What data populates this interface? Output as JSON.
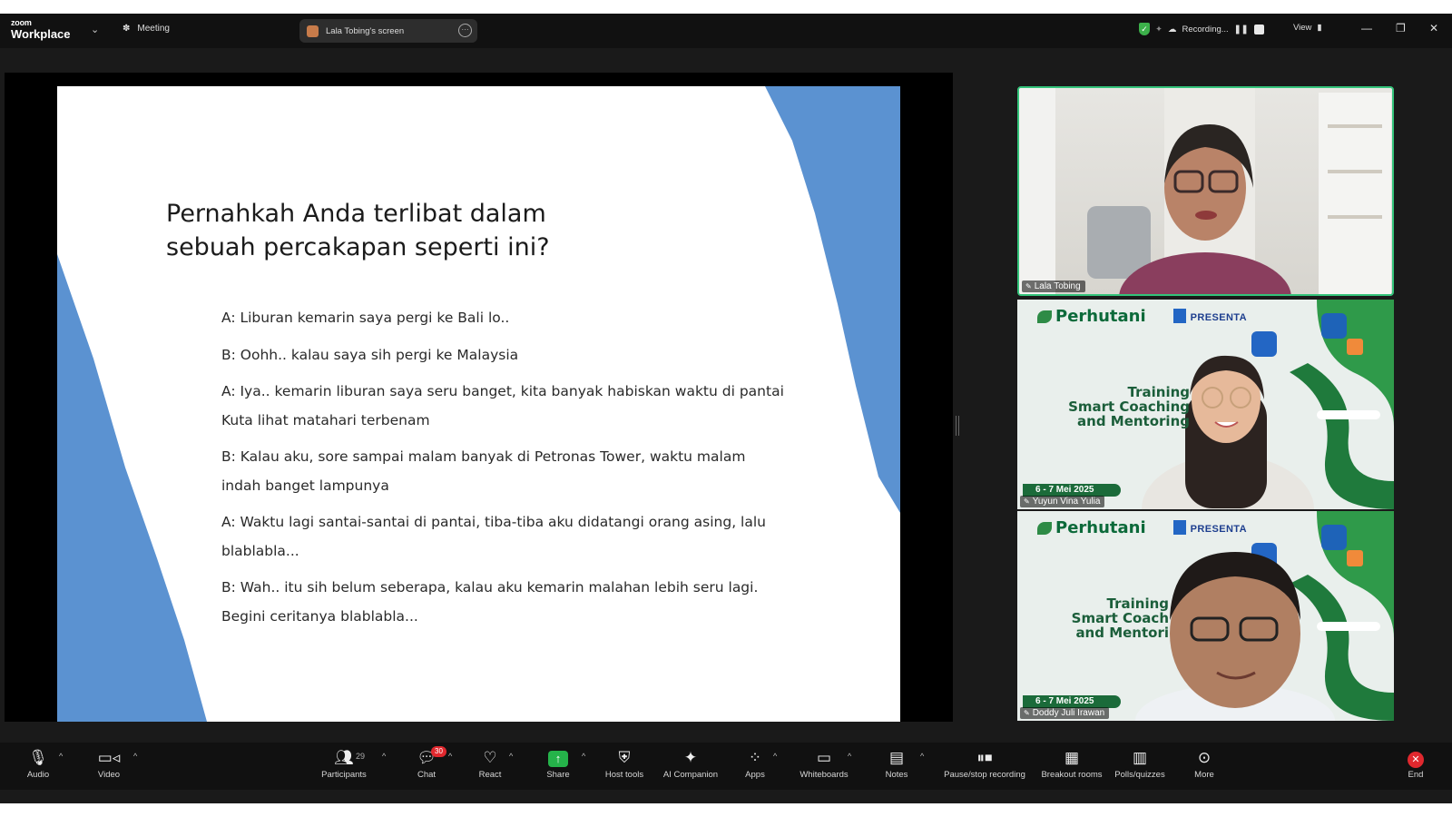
{
  "app": {
    "logo_top": "zoom",
    "logo_bottom": "Workplace",
    "meeting_label": "Meeting",
    "shared_screen_label": "Lala Tobing's screen",
    "recording_label": "Recording...",
    "view_label": "View"
  },
  "slide": {
    "title_line1": "Pernahkah Anda terlibat dalam",
    "title_line2": "sebuah percakapan seperti ini?",
    "lines": [
      "A: Liburan kemarin saya pergi ke Bali lo..",
      "B: Oohh.. kalau saya sih pergi ke Malaysia",
      "A: Iya.. kemarin liburan saya seru banget, kita banyak habiskan waktu di pantai Kuta lihat matahari terbenam",
      "B: Kalau aku, sore sampai malam banyak di Petronas Tower, waktu malam indah banget lampunya",
      "A: Waktu lagi santai-santai di pantai, tiba-tiba aku didatangi orang asing, lalu blablabla...",
      "B: Wah.. itu sih belum seberapa, kalau aku kemarin malahan lebih seru lagi. Begini ceritanya blablabla..."
    ],
    "accent_color": "#5b92d1"
  },
  "participants": [
    {
      "name": "Lala Tobing"
    },
    {
      "name": "Yuyun Vina Yulia",
      "brand": "Perhutani",
      "brand2": "PRESENTA",
      "training": [
        "Training",
        "Smart Coaching",
        "and Mentoring"
      ],
      "date": "6 - 7 Mei 2025"
    },
    {
      "name": "Doddy Juli Irawan",
      "brand": "Perhutani",
      "brand2": "PRESENTA",
      "training": [
        "Training",
        "Smart Coach",
        "and Mentori"
      ],
      "date": "6 - 7 Mei 2025"
    }
  ],
  "toolbar": {
    "audio": "Audio",
    "video": "Video",
    "participants": "Participants",
    "participants_count": "29",
    "chat": "Chat",
    "chat_badge": "30",
    "react": "React",
    "share": "Share",
    "host_tools": "Host tools",
    "ai_companion": "AI Companion",
    "apps": "Apps",
    "whiteboards": "Whiteboards",
    "notes": "Notes",
    "pause_recording": "Pause/stop recording",
    "breakout_rooms": "Breakout rooms",
    "polls": "Polls/quizzes",
    "more": "More",
    "end": "End"
  },
  "icons": [
    "mic-icon",
    "camera-icon",
    "people-icon",
    "chat-icon",
    "heart-icon",
    "share-arrow-icon",
    "shield-icon",
    "sparkle-icon",
    "apps-icon",
    "whiteboard-icon",
    "notes-icon",
    "pause-icon",
    "grid-icon",
    "bar-chart-icon",
    "ellipsis-icon",
    "close-icon"
  ]
}
